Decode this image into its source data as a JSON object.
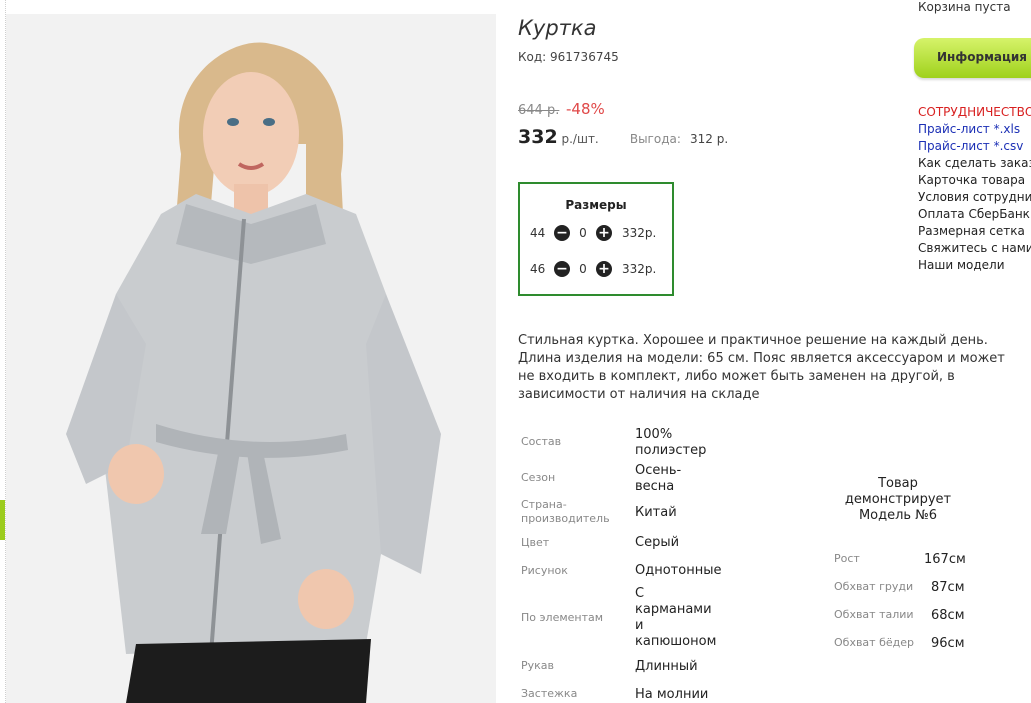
{
  "product": {
    "title": "Куртка",
    "code": "Код: 961736745",
    "old_price": "644 р.",
    "discount": "-48%",
    "price": "332",
    "unit": " р./шт.",
    "savings_label": "Выгода:",
    "savings_value": "312 р."
  },
  "sizes": {
    "title": "Размеры",
    "rows": [
      {
        "size": "44",
        "qty": "0",
        "price": "332р."
      },
      {
        "size": "46",
        "qty": "0",
        "price": "332р."
      }
    ],
    "minus_icon": "−",
    "plus_icon": "+"
  },
  "description": "Стильная куртка. Хорошее и практичное решение на каждый день. Длина изделия на модели: 65 см. Пояс является аксессуаром и может не входить в комплект, либо может быть заменен на другой, в зависимости от наличия на складе",
  "attributes": [
    {
      "label": "Состав",
      "value": "100% полиэстер"
    },
    {
      "label": "Сезон",
      "value": "Осень-весна"
    },
    {
      "label": "Страна-производитель",
      "value": "Китай"
    },
    {
      "label": "Цвет",
      "value": "Серый"
    },
    {
      "label": "Рисунок",
      "value": "Однотонные"
    },
    {
      "label": "По элементам",
      "value": "С карманами и капюшоном"
    },
    {
      "label": "Рукав",
      "value": "Длинный"
    },
    {
      "label": "Застежка",
      "value": "На молнии"
    }
  ],
  "model": {
    "note": "Товар демонстрирует Модель №6",
    "measurements": [
      {
        "label": "Рост",
        "value": "167см"
      },
      {
        "label": "Обхват груди",
        "value": "87см"
      },
      {
        "label": "Обхват талии",
        "value": "68см"
      },
      {
        "label": "Обхват бёдер",
        "value": "96см"
      }
    ]
  },
  "sidebar": {
    "cart": "Корзина пуста",
    "info_button": "Информация",
    "links": [
      {
        "label": "СОТРУДНИЧЕСТВО",
        "style": "red"
      },
      {
        "label": "Прайс-лист *.xls",
        "style": "blue"
      },
      {
        "label": "Прайс-лист *.csv",
        "style": "blue"
      },
      {
        "label": "Как сделать заказ",
        "style": "plain"
      },
      {
        "label": "Карточка товара",
        "style": "plain"
      },
      {
        "label": "Условия сотрудничества",
        "style": "plain"
      },
      {
        "label": "Оплата СберБанк",
        "style": "plain"
      },
      {
        "label": "Размерная сетка",
        "style": "plain"
      },
      {
        "label": "Свяжитесь с нами",
        "style": "plain"
      },
      {
        "label": "Наши модели",
        "style": "plain"
      }
    ]
  },
  "colors": {
    "accent_green": "#2e8b2e",
    "discount_red": "#e04848",
    "link_blue": "#1b2fb5",
    "button_green": "#9fd11c"
  }
}
